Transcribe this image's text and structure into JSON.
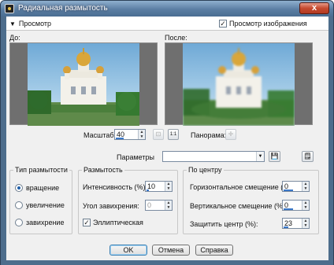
{
  "window": {
    "title": "Радиальная размытость",
    "close_glyph": "x"
  },
  "preview_bar": {
    "toggle_arrow": "▼",
    "toggle_label": "Просмотр",
    "show_preview_checked_glyph": "✓",
    "show_preview_label": "Просмотр изображения"
  },
  "panes": {
    "before_label": "До:",
    "after_label": "После:"
  },
  "zoom": {
    "label": "Масштаб:",
    "value": "40",
    "fit_glyph": "⊡",
    "actual_glyph": "1:1"
  },
  "pan": {
    "label": "Панорама:",
    "glyph": "✛"
  },
  "presets": {
    "label": "Параметры",
    "value": "",
    "arrow": "▼",
    "save_glyph": "💾",
    "load_glyph": "🗒"
  },
  "blur_type": {
    "title": "Тип размытости",
    "options": [
      {
        "label": "вращение",
        "selected": true
      },
      {
        "label": "увеличение",
        "selected": false
      },
      {
        "label": "завихрение",
        "selected": false
      }
    ]
  },
  "blur": {
    "title": "Размытость",
    "intensity_label": "Интенсивность (%):",
    "intensity_value": "10",
    "twist_label": "Угол завихрения:",
    "twist_value": "0",
    "elliptical_label": "Эллиптическая",
    "elliptical_checked_glyph": "✓"
  },
  "center": {
    "title": "По центру",
    "h_offset_label": "Горизонтальное смещение (%):",
    "h_offset_value": "0",
    "v_offset_label": "Вертикальное смещение (%):",
    "v_offset_value": "0",
    "protect_label": "Защитить центр (%):",
    "protect_value": "23"
  },
  "buttons": {
    "ok": "OK",
    "cancel": "Отмена",
    "help": "Справка"
  },
  "icons": {
    "app": "app-icon",
    "close": "close-icon",
    "arrow": "chevron-down-icon",
    "save": "save-icon",
    "load": "load-icon",
    "pan": "pan-icon"
  },
  "colors": {
    "accent": "#3b78c8",
    "titlebar": "#5b7ea3",
    "close": "#c64a2f"
  }
}
